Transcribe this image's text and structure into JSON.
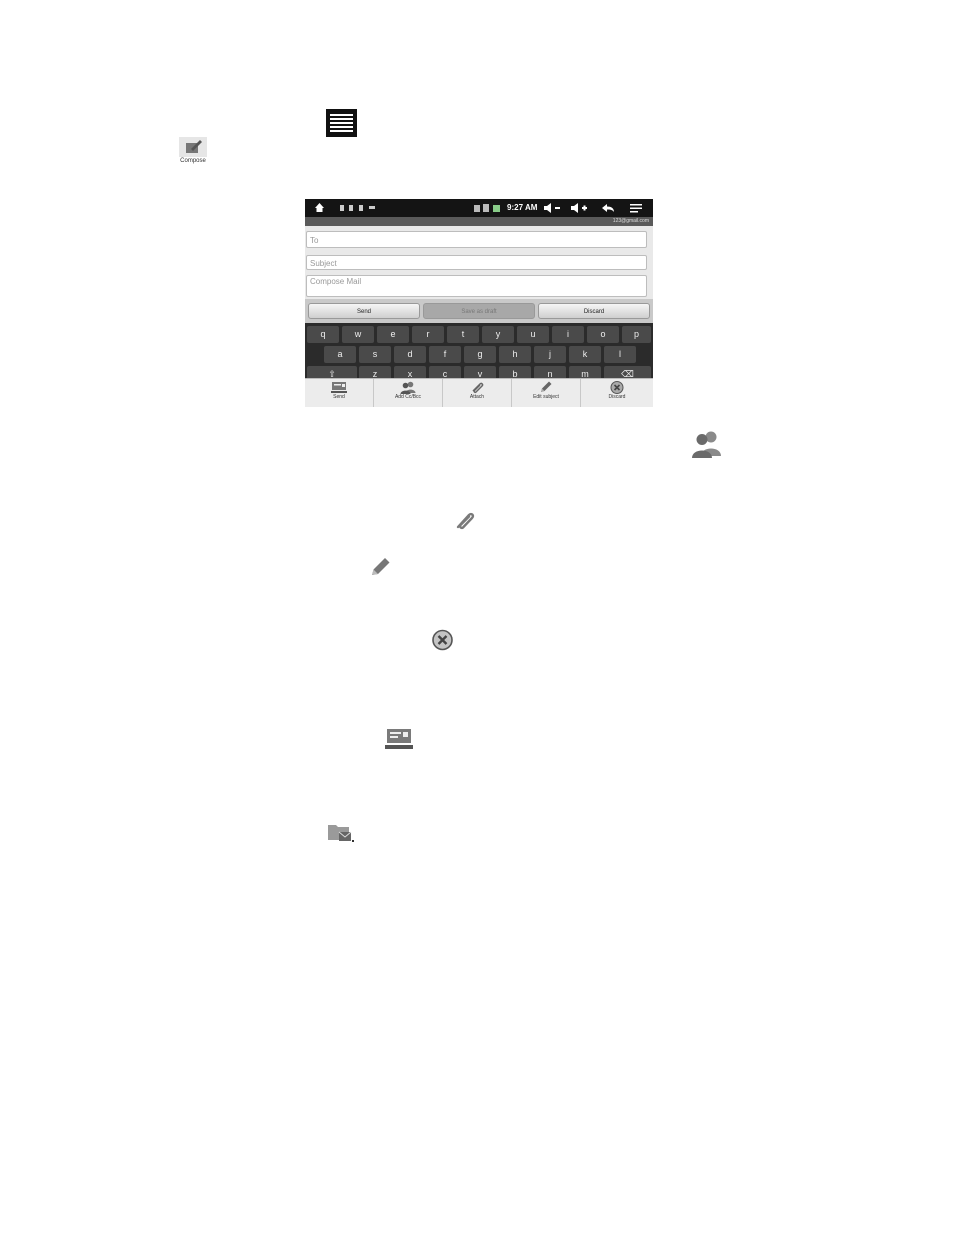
{
  "compose_icon": {
    "label": "Compose"
  },
  "status_bar": {
    "time": "9:27 AM"
  },
  "account": {
    "email": "123@gmail.com"
  },
  "fields": {
    "to": "To",
    "subject": "Subject",
    "body": "Compose Mail"
  },
  "buttons": {
    "send": "Send",
    "save_draft": "Save as draft",
    "discard": "Discard"
  },
  "keyboard": {
    "row1": [
      "q",
      "w",
      "e",
      "r",
      "t",
      "y",
      "u",
      "i",
      "o",
      "p"
    ],
    "row2": [
      "a",
      "s",
      "d",
      "f",
      "g",
      "h",
      "j",
      "k",
      "l"
    ],
    "row3": [
      "⇧",
      "z",
      "x",
      "c",
      "v",
      "b",
      "n",
      "m",
      "⌫"
    ]
  },
  "options": {
    "send": "Send",
    "add_cc_bcc": "Add Cc/Bcc",
    "attach": "Attach",
    "edit_subject": "Edit subject",
    "discard": "Discard"
  }
}
